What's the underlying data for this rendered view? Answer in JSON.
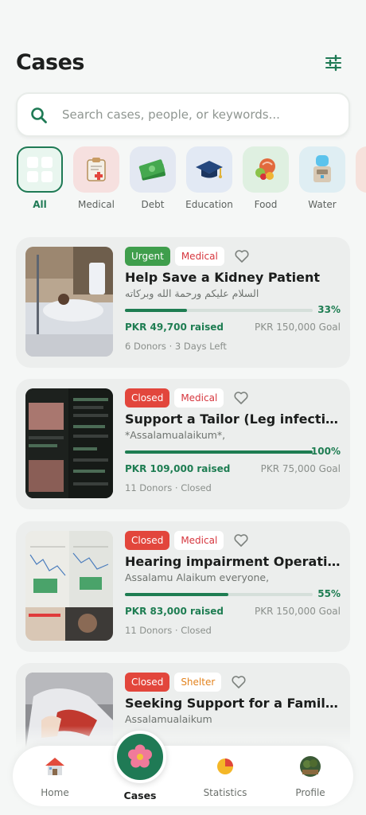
{
  "header": {
    "title": "Cases"
  },
  "search": {
    "placeholder": "Search cases, people, or keywords..."
  },
  "categories": [
    {
      "label": "All",
      "icon": "grid-icon",
      "active": true
    },
    {
      "label": "Medical",
      "icon": "medical-clipboard-icon"
    },
    {
      "label": "Debt",
      "icon": "money-icon"
    },
    {
      "label": "Education",
      "icon": "graduation-cap-icon"
    },
    {
      "label": "Food",
      "icon": "food-icon"
    },
    {
      "label": "Water",
      "icon": "water-dispenser-icon"
    }
  ],
  "cases": [
    {
      "status": "Urgent",
      "category": "Medical",
      "title": "Help Save a Kidney Patient",
      "subtitle": "السلام عليكم ورحمة الله وبركاته",
      "progress_pct": 33,
      "progress_label": "33%",
      "raised": "PKR 49,700 raised",
      "goal": "PKR 150,000 Goal",
      "meta": "6 Donors · 3 Days Left"
    },
    {
      "status": "Closed",
      "category": "Medical",
      "title": "Support a Tailor (Leg infection)",
      "subtitle": "*Assalamualaikum*,",
      "progress_pct": 100,
      "progress_label": "100%",
      "raised": "PKR 109,000 raised",
      "goal": "PKR 75,000 Goal",
      "meta": "11 Donors · Closed"
    },
    {
      "status": "Closed",
      "category": "Medical",
      "title": "Hearing impairment Operation",
      "subtitle": "Assalamu Alaikum everyone,",
      "progress_pct": 55,
      "progress_label": "55%",
      "raised": "PKR 83,000 raised",
      "goal": "PKR 150,000 Goal",
      "meta": "11 Donors · Closed"
    },
    {
      "status": "Closed",
      "category": "Shelter",
      "title": "Seeking Support for a Family in Need",
      "subtitle": "Assalamualaikum"
    }
  ],
  "nav": {
    "home": "Home",
    "cases": "Cases",
    "statistics": "Statistics",
    "profile": "Profile"
  },
  "colors": {
    "primary": "#1f7a55",
    "urgent": "#3f9e4c",
    "closed": "#e2463c",
    "medical": "#d6363e",
    "shelter": "#e3831e"
  }
}
